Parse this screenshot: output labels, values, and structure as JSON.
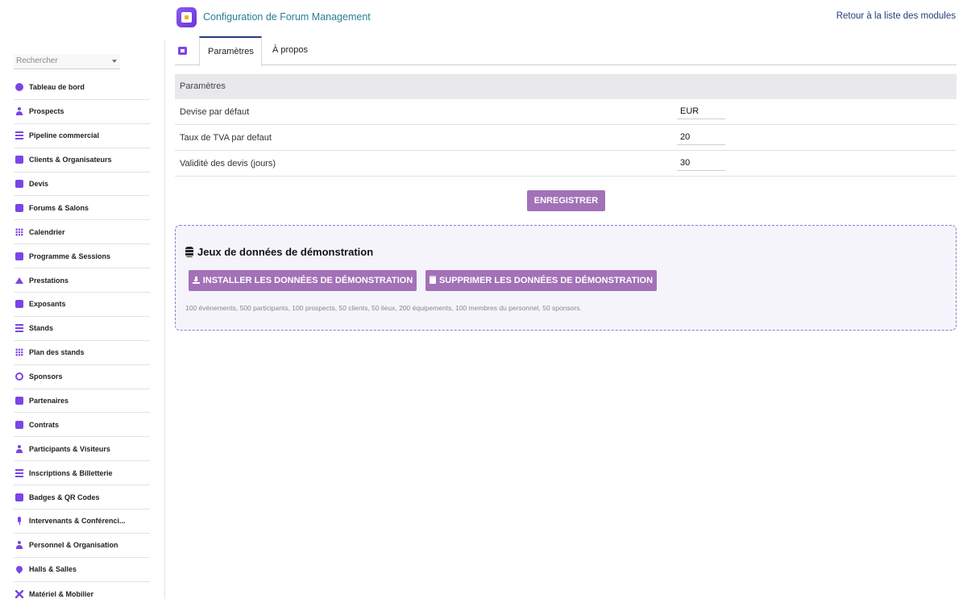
{
  "header": {
    "title": "Configuration de Forum Management",
    "back_link": "Retour à la liste des modules"
  },
  "sidebar": {
    "search_placeholder": "Rechercher",
    "items": [
      {
        "label": "Tableau de bord",
        "icon": "dashboard-icon"
      },
      {
        "label": "Prospects",
        "icon": "user-plus-icon"
      },
      {
        "label": "Pipeline commercial",
        "icon": "bars-icon"
      },
      {
        "label": "Clients & Organisateurs",
        "icon": "building-icon"
      },
      {
        "label": "Devis",
        "icon": "file-icon"
      },
      {
        "label": "Forums & Salons",
        "icon": "calendar-star-icon"
      },
      {
        "label": "Calendrier",
        "icon": "calendar-icon"
      },
      {
        "label": "Programme & Sessions",
        "icon": "presentation-icon"
      },
      {
        "label": "Prestations",
        "icon": "service-icon"
      },
      {
        "label": "Exposants",
        "icon": "store-icon"
      },
      {
        "label": "Stands",
        "icon": "stand-icon"
      },
      {
        "label": "Plan des stands",
        "icon": "grid-icon"
      },
      {
        "label": "Sponsors",
        "icon": "medal-icon"
      },
      {
        "label": "Partenaires",
        "icon": "handshake-icon"
      },
      {
        "label": "Contrats",
        "icon": "contract-icon"
      },
      {
        "label": "Participants & Visiteurs",
        "icon": "user-check-icon"
      },
      {
        "label": "Inscriptions & Billetterie",
        "icon": "ticket-icon"
      },
      {
        "label": "Badges & QR Codes",
        "icon": "badge-icon"
      },
      {
        "label": "Intervenants & Conférenci...",
        "icon": "microphone-icon"
      },
      {
        "label": "Personnel & Organisation",
        "icon": "person-icon"
      },
      {
        "label": "Halls & Salles",
        "icon": "location-pin-icon"
      },
      {
        "label": "Matériel & Mobilier",
        "icon": "tools-icon"
      }
    ]
  },
  "tabs": [
    {
      "label": "Paramètres"
    },
    {
      "label": "À propos"
    }
  ],
  "params": {
    "header": "Paramètres",
    "rows": [
      {
        "label": "Devise par défaut",
        "value": "EUR"
      },
      {
        "label": "Taux de TVA par defaut",
        "value": "20"
      },
      {
        "label": "Validité des devis (jours)",
        "value": "30"
      }
    ],
    "save_label": "ENREGISTRER"
  },
  "demo": {
    "title": "Jeux de données de démonstration",
    "install_label": "INSTALLER LES DONNÉES DE DÉMONSTRATION",
    "delete_label": "SUPPRIMER LES DONNÉES DE DÉMONSTRATION",
    "note": "100 événements, 500 participants, 100 prospects, 50 clients, 50 lieux, 200 équipements, 100 membres du personnel, 50 sponsors."
  },
  "colors": {
    "accent": "#7b45e6",
    "button": "#a271b7",
    "title": "#2a7e96",
    "link": "#263c7a"
  }
}
